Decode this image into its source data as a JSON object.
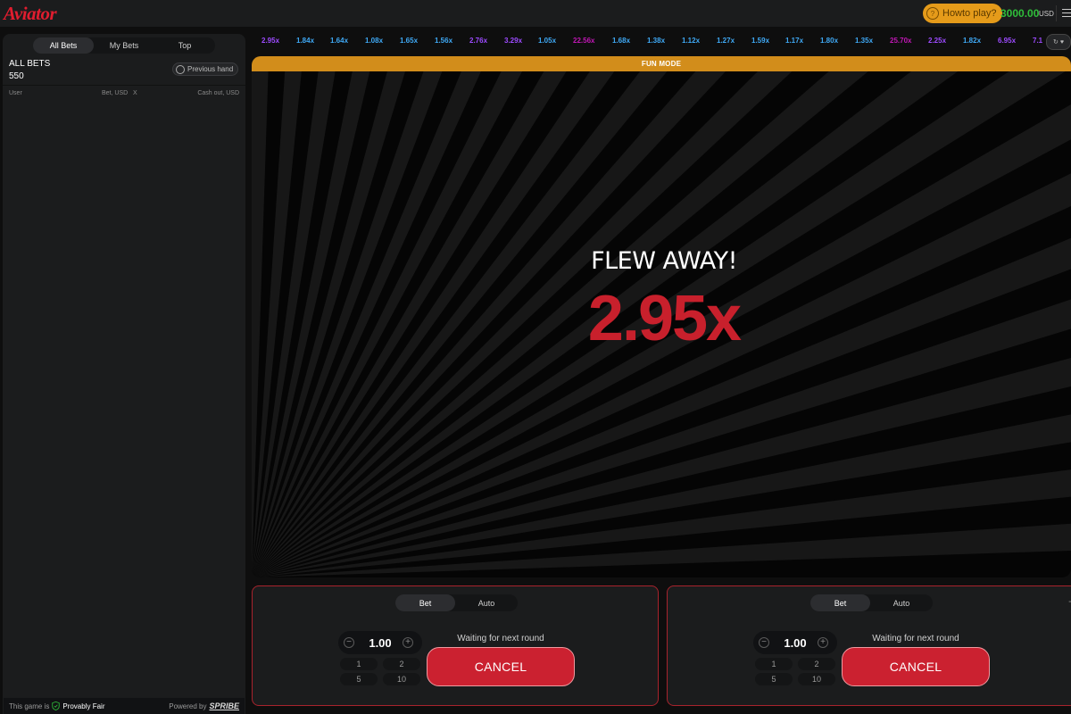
{
  "header": {
    "logo": "Aviator",
    "how_to_play": "Howto play?",
    "balance": "3000.00",
    "currency": "USD"
  },
  "left": {
    "tabs": [
      "All Bets",
      "My Bets",
      "Top"
    ],
    "active_tab": "All Bets",
    "all_bets_title": "ALL BETS",
    "all_bets_count": "550",
    "previous_hand": "Previous hand",
    "columns": {
      "user": "User",
      "bet": "Bet, USD",
      "x": "X",
      "cashout": "Cash out, USD"
    },
    "footer": {
      "game_is": "This game is",
      "provably_fair": "Provably Fair",
      "powered_by": "Powered by",
      "provider": "SPRIBE"
    }
  },
  "history": [
    {
      "label": "2.95x",
      "color": "#9d4bff"
    },
    {
      "label": "1.84x",
      "color": "#3fa9f5"
    },
    {
      "label": "1.64x",
      "color": "#3fa9f5"
    },
    {
      "label": "1.08x",
      "color": "#3fa9f5"
    },
    {
      "label": "1.65x",
      "color": "#3fa9f5"
    },
    {
      "label": "1.56x",
      "color": "#3fa9f5"
    },
    {
      "label": "2.76x",
      "color": "#9d4bff"
    },
    {
      "label": "3.29x",
      "color": "#9d4bff"
    },
    {
      "label": "1.05x",
      "color": "#3fa9f5"
    },
    {
      "label": "22.56x",
      "color": "#c017b4"
    },
    {
      "label": "1.68x",
      "color": "#3fa9f5"
    },
    {
      "label": "1.38x",
      "color": "#3fa9f5"
    },
    {
      "label": "1.12x",
      "color": "#3fa9f5"
    },
    {
      "label": "1.27x",
      "color": "#3fa9f5"
    },
    {
      "label": "1.59x",
      "color": "#3fa9f5"
    },
    {
      "label": "1.17x",
      "color": "#3fa9f5"
    },
    {
      "label": "1.80x",
      "color": "#3fa9f5"
    },
    {
      "label": "1.35x",
      "color": "#3fa9f5"
    },
    {
      "label": "25.70x",
      "color": "#c017b4"
    },
    {
      "label": "2.25x",
      "color": "#9d4bff"
    },
    {
      "label": "1.82x",
      "color": "#3fa9f5"
    },
    {
      "label": "6.95x",
      "color": "#9d4bff"
    },
    {
      "label": "7.1",
      "color": "#9d4bff"
    }
  ],
  "game": {
    "fun_mode": "FUN MODE",
    "flew_away": "FLEW AWAY!",
    "multiplier": "2.95x"
  },
  "bet_panels": [
    {
      "tabs": [
        "Bet",
        "Auto"
      ],
      "amount": "1.00",
      "quick": [
        "1",
        "2",
        "5",
        "10"
      ],
      "status": "Waiting for next round",
      "button": "CANCEL"
    },
    {
      "tabs": [
        "Bet",
        "Auto"
      ],
      "amount": "1.00",
      "quick": [
        "1",
        "2",
        "5",
        "10"
      ],
      "status": "Waiting for next round",
      "button": "CANCEL"
    }
  ],
  "colors": {
    "accent_red": "#c8202c",
    "fun_bar": "#d28d1b",
    "balance_green": "#2fbf3a"
  },
  "icons": [
    "question-icon",
    "menu-icon",
    "history-icon",
    "shield-check-icon",
    "minus-icon",
    "plus-icon",
    "heart-icon"
  ]
}
